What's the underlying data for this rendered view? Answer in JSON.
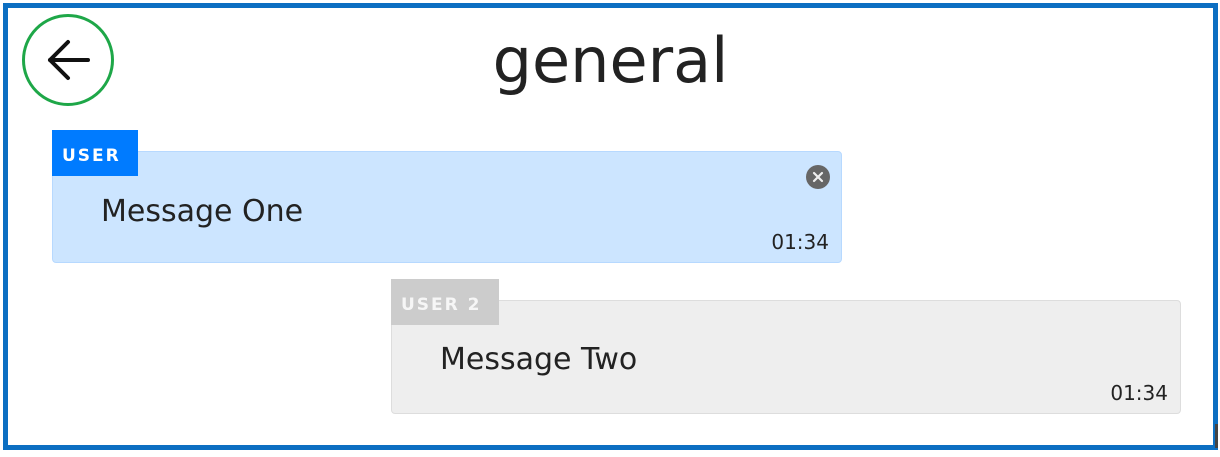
{
  "header": {
    "title": "general",
    "back_icon": "arrow-left-icon",
    "back_highlight_color": "#1ea748"
  },
  "colors": {
    "frame_border": "#0c6fc2",
    "own_message_bg": "#cce5ff",
    "own_tag_bg": "#007bff",
    "other_message_bg": "#eeeeee",
    "other_tag_bg": "#cccccc"
  },
  "messages": [
    {
      "user": "USER",
      "text": "Message One",
      "time": "01:34",
      "close_icon": "close-circle-icon"
    },
    {
      "user": "USER 2",
      "text": "Message Two",
      "time": "01:34"
    }
  ]
}
